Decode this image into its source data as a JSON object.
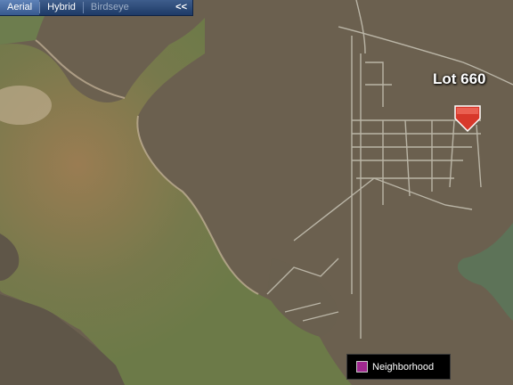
{
  "view_tabs": {
    "aerial": "Aerial",
    "hybrid": "Hybrid",
    "birdseye": "Birdseye",
    "collapse": "<<"
  },
  "marker": {
    "label": "Lot 660",
    "icon": "map-pin-icon",
    "color": "#e8473a"
  },
  "legend": {
    "label": "Neighborhood",
    "swatch_color": "#a0288f"
  },
  "colors": {
    "water": "#6f7a4c",
    "land": "#6b6050",
    "tab_bar": "#2a4a7a"
  }
}
